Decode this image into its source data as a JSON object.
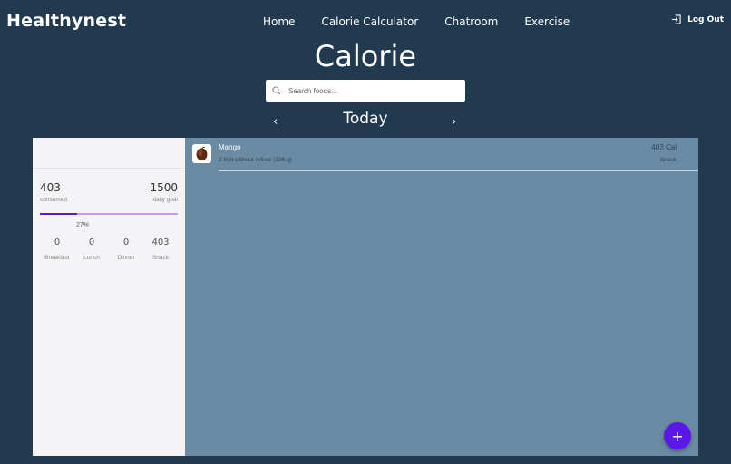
{
  "brand": "Healthynest",
  "nav": {
    "home": "Home",
    "calorie_calculator": "Calorie Calculator",
    "chatroom": "Chatroom",
    "exercise": "Exercise",
    "logout": "Log Out"
  },
  "page_title": "Calorie",
  "search": {
    "placeholder": "Search foods...",
    "value": ""
  },
  "day": {
    "label": "Today",
    "prev": "‹",
    "next": "›"
  },
  "summary": {
    "consumed": "403",
    "consumed_label": "consumed",
    "goal": "1500",
    "goal_label": "daily goal",
    "progress_fraction": 0.27,
    "percent": "27%",
    "meals": [
      {
        "value": "0",
        "label": "Breakfast"
      },
      {
        "value": "0",
        "label": "Lunch"
      },
      {
        "value": "0",
        "label": "Dinner"
      },
      {
        "value": "403",
        "label": "Snack"
      }
    ]
  },
  "foods": [
    {
      "name": "Mango",
      "description": "2 fruit without refuse (336 g)",
      "calories": "403 Cal",
      "meal": "Snack",
      "icon": "mango-icon"
    }
  ],
  "fab": {
    "label": "+"
  },
  "colors": {
    "background": "#213a4f",
    "panel_left": "#f4f4f6",
    "panel_right": "#6a8ba3",
    "progress_fill": "#5a1fc0",
    "progress_track": "#c79ae8",
    "fab": "#5b17e6"
  }
}
